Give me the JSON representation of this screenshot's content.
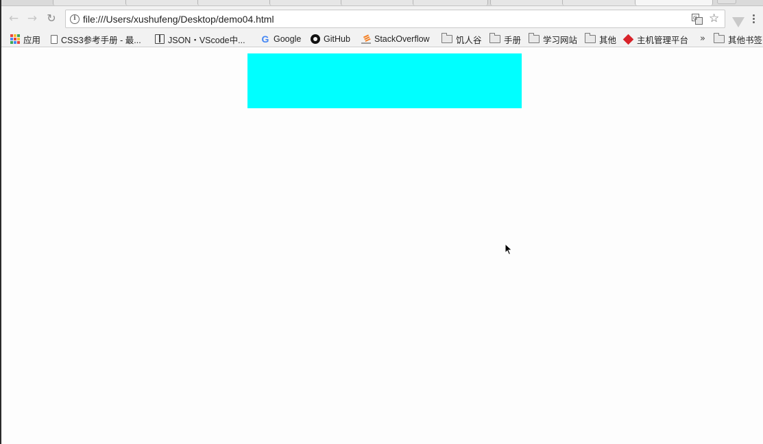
{
  "browser": {
    "url": "file:///Users/xushufeng/Desktop/demo04.html",
    "tabs_favicons": [
      "page",
      "page",
      "green",
      "red",
      "page",
      "blue",
      "page",
      "bluepin",
      "page"
    ]
  },
  "bookmarks": {
    "apps_label": "应用",
    "items": [
      {
        "label": "CSS3参考手册 - 最...",
        "icon": "page-icon"
      },
      {
        "label": "JSON・VScode中...",
        "icon": "book-icon"
      },
      {
        "label": "Google",
        "icon": "google-icon"
      },
      {
        "label": "GitHub",
        "icon": "github-icon"
      },
      {
        "label": "StackOverflow",
        "icon": "stackoverflow-icon"
      },
      {
        "label": "饥人谷",
        "icon": "folder-icon"
      },
      {
        "label": "手册",
        "icon": "folder-icon"
      },
      {
        "label": "学习网站",
        "icon": "folder-icon"
      },
      {
        "label": "其他",
        "icon": "folder-icon"
      },
      {
        "label": "主机管理平台",
        "icon": "diamond-icon"
      }
    ],
    "overflow_label": "»",
    "other_bookmarks_label": "其他书签"
  },
  "page": {
    "box_color": "#00ffff"
  }
}
